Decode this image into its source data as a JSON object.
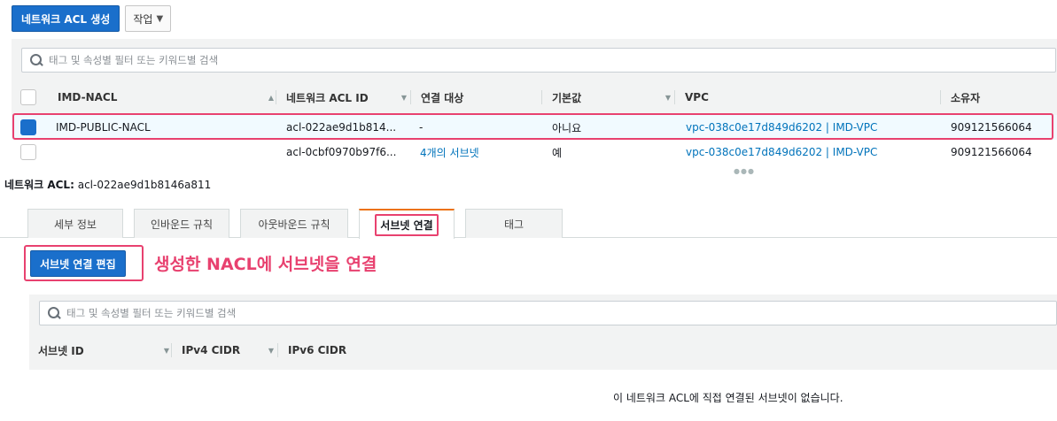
{
  "toolbar": {
    "create_label": "네트워크 ACL 생성",
    "actions_label": "작업"
  },
  "search": {
    "placeholder": "태그 및 속성별 필터 또는 키워드별 검색"
  },
  "table": {
    "columns": [
      "IMD-NACL",
      "네트워크 ACL ID",
      "연결 대상",
      "기본값",
      "VPC",
      "소유자"
    ],
    "rows": [
      {
        "name": "IMD-PUBLIC-NACL",
        "acl_id": "acl-022ae9d1b814...",
        "associated": "-",
        "default": "아니요",
        "vpc": "vpc-038c0e17d849d6202 | IMD-VPC",
        "owner": "909121566064",
        "selected": true
      },
      {
        "name": "",
        "acl_id": "acl-0cbf0970b97f6...",
        "associated": "4개의 서브넷",
        "default": "예",
        "vpc": "vpc-038c0e17d849d6202 | IMD-VPC",
        "owner": "909121566064",
        "selected": false
      }
    ]
  },
  "details": {
    "label": "네트워크 ACL:",
    "acl_id": "acl-022ae9d1b8146a811"
  },
  "tabs": [
    "세부 정보",
    "인바운드 규칙",
    "아웃바운드 규칙",
    "서브넷 연결",
    "태그"
  ],
  "active_tab": "서브넷 연결",
  "subnet_section": {
    "edit_button": "서브넷 연결 편집",
    "annotation": "생성한 NACL에 서브넷을 연결",
    "search_placeholder": "태그 및 속성별 필터 또는 키워드별 검색",
    "columns": [
      "서브넷 ID",
      "IPv4 CIDR",
      "IPv6 CIDR"
    ],
    "empty_message": "이 네트워크 ACL에 직접 연결된 서브넷이 없습니다."
  },
  "colors": {
    "primary": "#1a6fcb",
    "highlight": "#e8416f",
    "link": "#0073bb",
    "tab_accent": "#ec7211"
  }
}
